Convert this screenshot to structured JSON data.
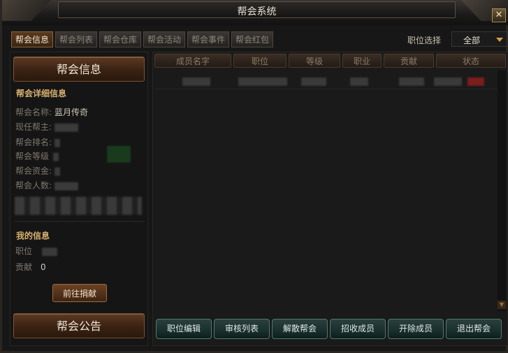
{
  "window": {
    "title": "帮会系统",
    "close_label": "✕"
  },
  "tabs": [
    {
      "label": "帮会信息",
      "active": true
    },
    {
      "label": "帮会列表"
    },
    {
      "label": "帮会仓库"
    },
    {
      "label": "帮会活动"
    },
    {
      "label": "帮会事件"
    },
    {
      "label": "帮会红包"
    }
  ],
  "position_filter": {
    "label": "职位选择",
    "value": "全部"
  },
  "left_panel": {
    "header_button": "帮会信息",
    "detail_title": "帮会详细信息",
    "fields": {
      "name_label": "帮会名称:",
      "name_value": "蓝月传奇",
      "leader_label": "现任帮主:",
      "rank_label": "帮会排名:",
      "level_label": "帮会等级",
      "funds_label": "帮会资金:",
      "members_label": "帮会人数:"
    },
    "my_info_title": "我的信息",
    "my_position_label": "职位",
    "my_contribution_label": "贡献",
    "my_contribution_value": "0",
    "donate_button": "前往捐献",
    "announcement_button": "帮会公告"
  },
  "table": {
    "columns": [
      "成员名字",
      "职位",
      "等级",
      "职业",
      "贡献",
      "状态"
    ]
  },
  "actions": [
    "职位编辑",
    "审核列表",
    "解散帮会",
    "招收成员",
    "开除成员",
    "退出帮会"
  ],
  "colors": {
    "accent": "#d8b070",
    "action_teal": "#2c3f3c"
  }
}
